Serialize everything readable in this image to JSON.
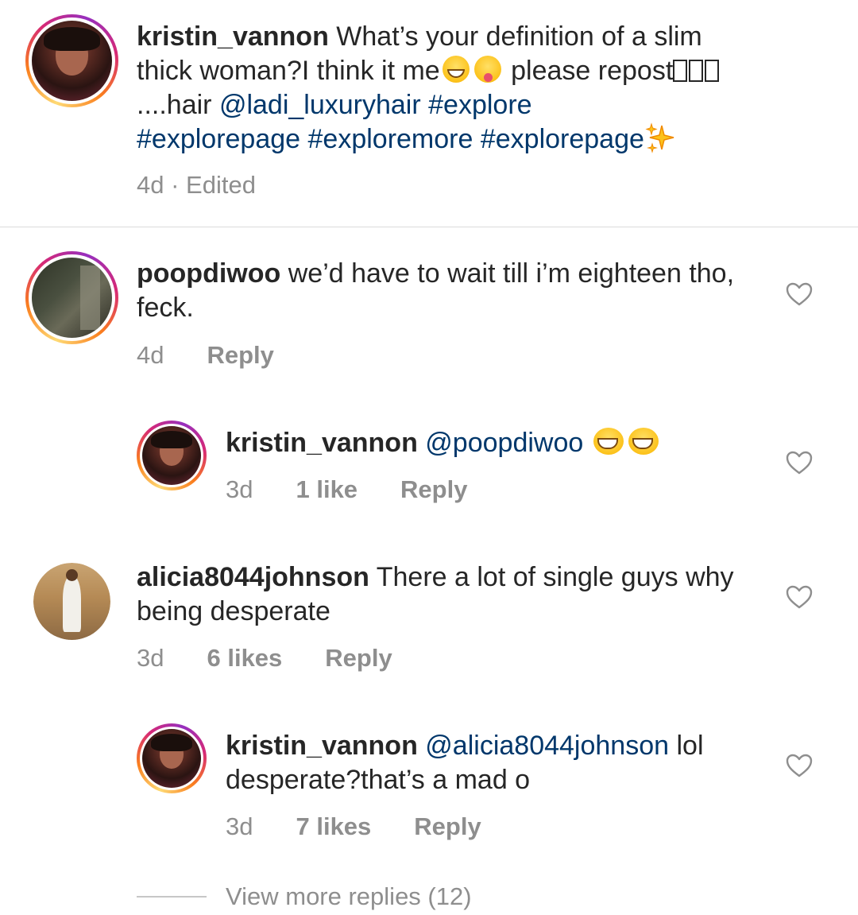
{
  "caption": {
    "username": "kristin_vannon",
    "text_part1": "What’s your definition of a slim thick woman?I think it me",
    "text_part2": " please repost",
    "text_part3": "....hair ",
    "mention": "@ladi_luxuryhair",
    "hashtags_line1": " #explore",
    "hashtags_line2": "#explorepage #exploremore #explorepage",
    "time": "4d",
    "separator": " · ",
    "edited": "Edited"
  },
  "comments": [
    {
      "username": "poopdiwoo",
      "text": "we’d have to wait till i’m eighteen tho, feck.",
      "time": "4d",
      "reply_label": "Reply"
    },
    {
      "username": "kristin_vannon",
      "mention": "@poopdiwoo",
      "time": "3d",
      "likes": "1 like",
      "reply_label": "Reply"
    },
    {
      "username": "alicia8044johnson",
      "text": "There a lot of single guys why being desperate",
      "time": "3d",
      "likes": "6 likes",
      "reply_label": "Reply"
    },
    {
      "username": "kristin_vannon",
      "mention": "@alicia8044johnson",
      "text": " lol desperate?that’s a mad o",
      "time": "3d",
      "likes": "7 likes",
      "reply_label": "Reply"
    }
  ],
  "view_more_replies": "View more replies (12)",
  "icons": {
    "heart": "heart-outline-icon",
    "emoji_grin": "grinning-squinting-emoji-icon",
    "emoji_tongue": "face-with-tongue-emoji-icon",
    "emoji_laugh": "laughing-emoji-icon",
    "sparkles": "sparkles-emoji-icon"
  },
  "colors": {
    "text": "#262626",
    "link": "#00376b",
    "muted": "#8e8e8e",
    "divider": "#dbdbdb"
  }
}
